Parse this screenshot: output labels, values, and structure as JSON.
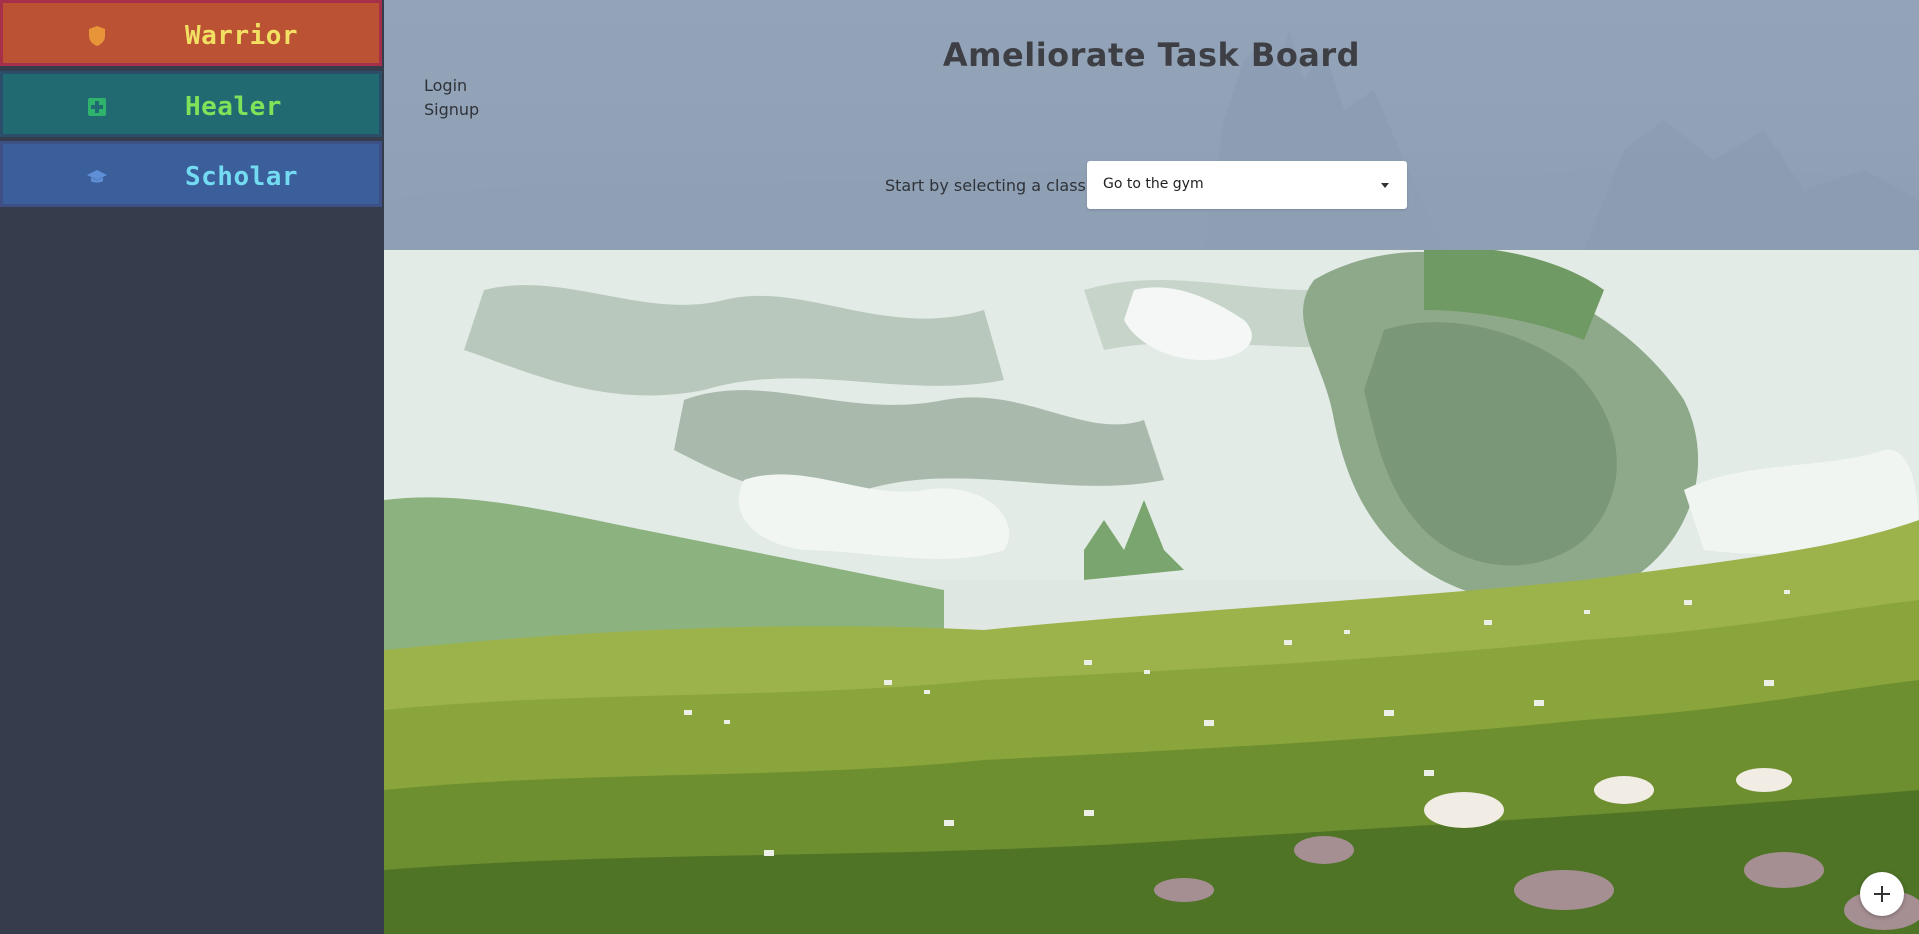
{
  "sidebar": {
    "classes": [
      {
        "label": "Warrior",
        "icon": "shield-icon",
        "text_color": "#f2e063",
        "icon_color": "#e8953a",
        "bg": "#bb5233"
      },
      {
        "label": "Healer",
        "icon": "medical-cross-icon",
        "text_color": "#7fe35a",
        "icon_color": "#2fb36b",
        "bg": "#226a71"
      },
      {
        "label": "Scholar",
        "icon": "graduation-cap-icon",
        "text_color": "#74dcf2",
        "icon_color": "#5f8fd6",
        "bg": "#3b5f9a"
      }
    ]
  },
  "header": {
    "title": "Ameliorate Task Board",
    "login_label": "Login",
    "signup_label": "Signup",
    "select_prompt": "Start by selecting a class",
    "select_value": "Go to the gym"
  },
  "fab": {
    "icon": "plus-icon"
  },
  "colors": {
    "sidebar_bg": "#353d4d",
    "header_bg": "#93a3b8"
  }
}
